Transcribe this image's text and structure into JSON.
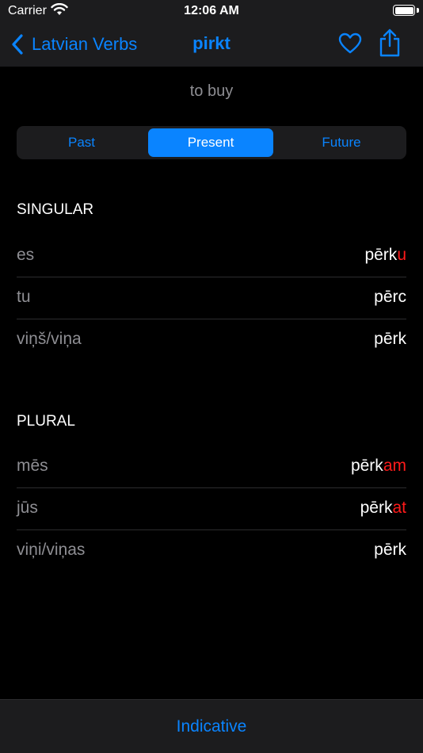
{
  "status_bar": {
    "carrier": "Carrier",
    "time": "12:06 AM",
    "battery_level": 1.0
  },
  "nav": {
    "back_label": "Latvian Verbs",
    "title": "pirkt"
  },
  "translation": "to buy",
  "tenses": {
    "options": [
      "Past",
      "Present",
      "Future"
    ],
    "selected": "Present"
  },
  "singular": {
    "header": "SINGULAR",
    "rows": [
      {
        "pronoun": "es",
        "stem": "pērk",
        "ending": "u"
      },
      {
        "pronoun": "tu",
        "stem": "pērc",
        "ending": ""
      },
      {
        "pronoun": "viņš/viņa",
        "stem": "pērk",
        "ending": ""
      }
    ]
  },
  "plural": {
    "header": "PLURAL",
    "rows": [
      {
        "pronoun": "mēs",
        "stem": "pērk",
        "ending": "am"
      },
      {
        "pronoun": "jūs",
        "stem": "pērk",
        "ending": "at"
      },
      {
        "pronoun": "viņi/viņas",
        "stem": "pērk",
        "ending": ""
      }
    ]
  },
  "tab_bar": {
    "label": "Indicative"
  },
  "colors": {
    "accent": "#0a84ff",
    "ending": "#ff1a1a",
    "background": "#000000",
    "bar": "#1c1c1e"
  }
}
